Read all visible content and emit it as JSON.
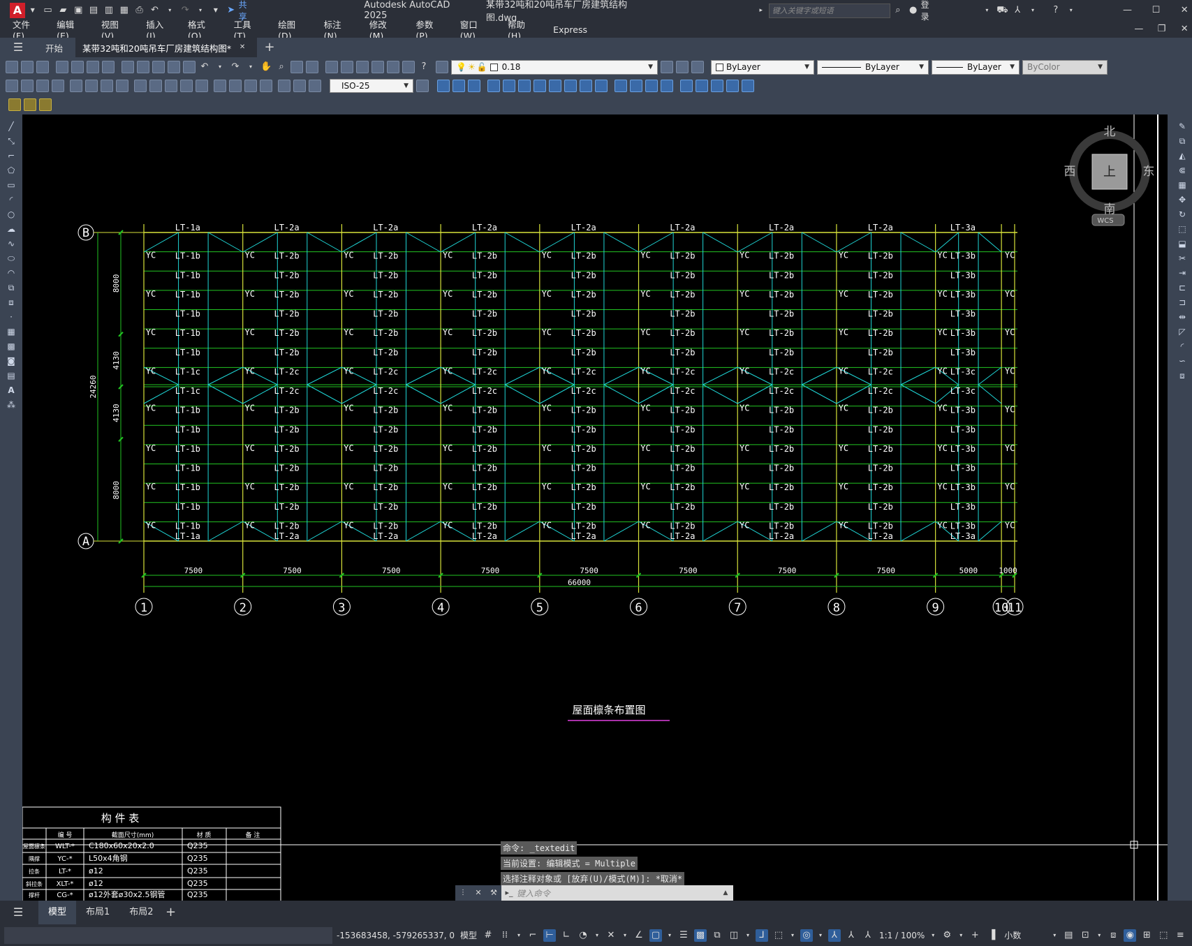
{
  "app": {
    "logo": "A",
    "share_label": "共享",
    "title": "Autodesk AutoCAD 2025",
    "file": "某带32吨和20吨吊车厂房建筑结构图.dwg",
    "search_placeholder": "键入关键字或短语",
    "login": "登录"
  },
  "menu": [
    "文件(F)",
    "编辑(E)",
    "视图(V)",
    "插入(I)",
    "格式(O)",
    "工具(T)",
    "绘图(D)",
    "标注(N)",
    "修改(M)",
    "参数(P)",
    "窗口(W)",
    "帮助(H)",
    "Express"
  ],
  "tabs": {
    "start": "开始",
    "doc": "某带32吨和20吨吊车厂房建筑结构图*"
  },
  "props": {
    "layer_value": "0.18",
    "color": "ByLayer",
    "linetype": "ByLayer",
    "lineweight": "ByLayer",
    "plotstyle": "ByColor",
    "dimstyle": "ISO-25"
  },
  "viewcube": {
    "north": "北",
    "south": "南",
    "east": "东",
    "west": "西",
    "face": "上",
    "wcs": "WCS"
  },
  "drawing": {
    "title": "屋面檩条布置图",
    "axis_cols": [
      "1",
      "2",
      "3",
      "4",
      "5",
      "6",
      "7",
      "8",
      "9",
      "10",
      "11"
    ],
    "axis_rows": [
      "B",
      "A"
    ],
    "spans": [
      "7500",
      "7500",
      "7500",
      "7500",
      "7500",
      "7500",
      "7500",
      "7500",
      "5000",
      "1000"
    ],
    "total": "66000",
    "vdims": [
      "8000",
      "4130",
      "4130",
      "8000"
    ],
    "vtotal": "24260",
    "yc": "YC",
    "purlin_top": [
      "LT-1a",
      "LT-2a",
      "LT-2a",
      "LT-2a",
      "LT-2a",
      "LT-2a",
      "LT-2a",
      "LT-2a",
      "LT-3a"
    ],
    "purlin_bottom": [
      "LT-1a",
      "LT-2a",
      "LT-2a",
      "LT-2a",
      "LT-2a",
      "LT-2a",
      "LT-2a",
      "LT-2a",
      "LT-3a"
    ],
    "purlin_b": [
      "LT-1b",
      "LT-2b",
      "LT-2b",
      "LT-2b",
      "LT-2b",
      "LT-2b",
      "LT-2b",
      "LT-2b",
      "LT-3b"
    ],
    "purlin_c": [
      "LT-1c",
      "LT-2c",
      "LT-2c",
      "LT-2c",
      "LT-2c",
      "LT-2c",
      "LT-2c",
      "LT-2c",
      "LT-3c"
    ]
  },
  "table": {
    "title": "构 件 表",
    "headers": [
      "编 号",
      "截面尺寸(mm)",
      "材 质",
      "备 注"
    ],
    "rows": [
      {
        "name": "屋面檩条",
        "code": "WLT-*",
        "section": "C180x60x20x2.0",
        "mat": "Q235"
      },
      {
        "name": "隅撑",
        "code": "YC-*",
        "section": "L50x4角钢",
        "mat": "Q235"
      },
      {
        "name": "拉条",
        "code": "LT-*",
        "section": "ø12",
        "mat": "Q235"
      },
      {
        "name": "斜拉条",
        "code": "XLT-*",
        "section": "ø12",
        "mat": "Q235"
      },
      {
        "name": "撑杆",
        "code": "CG-*",
        "section": "ø12外套ø30x2.5钢管",
        "mat": "Q235"
      }
    ]
  },
  "command": {
    "lines": [
      "命令: _textedit",
      "当前设置: 编辑模式 = Multiple",
      "选择注释对象或 [放弃(U)/模式(M)]: *取消*"
    ],
    "placeholder": "键入命令"
  },
  "layout_tabs": [
    "模型",
    "布局1",
    "布局2"
  ],
  "status": {
    "coords": "-153683458, -579265337, 0",
    "mode": "模型",
    "scale": "1:1 / 100%",
    "units": "小数"
  }
}
